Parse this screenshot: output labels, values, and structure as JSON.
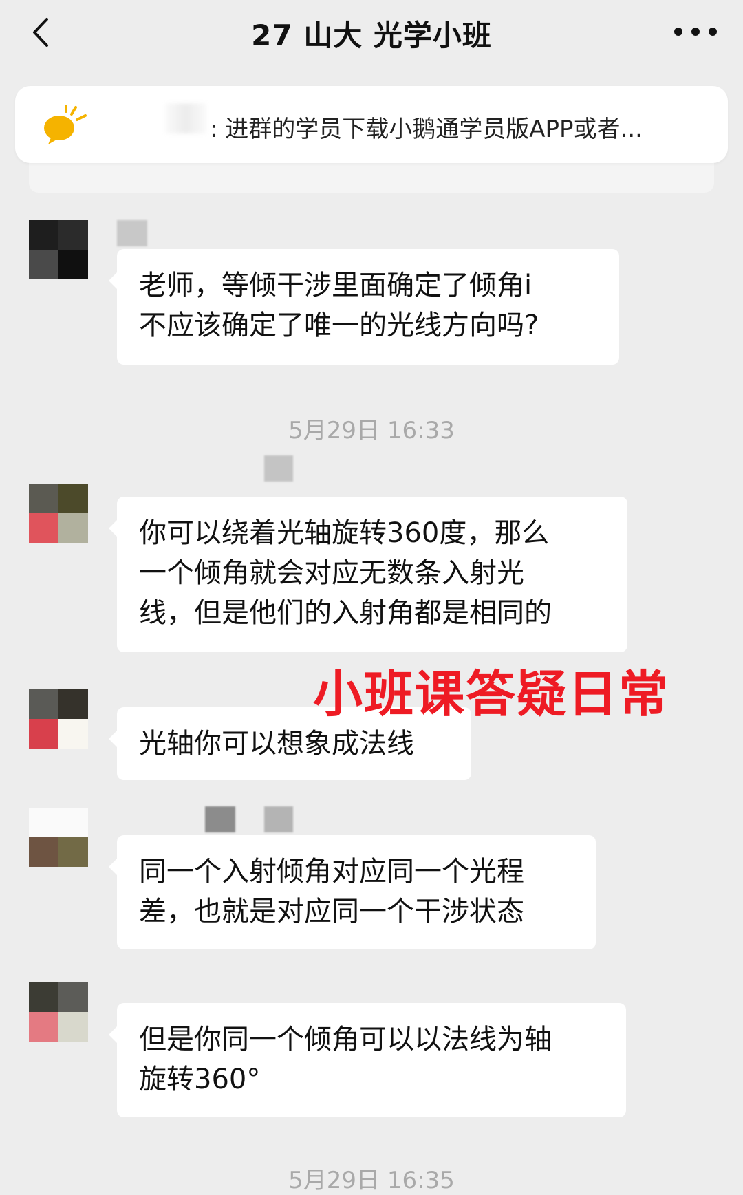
{
  "header": {
    "title": "27 山大 光学小班",
    "back_icon": "chevron-left-icon",
    "more_icon": "more-dots-icon"
  },
  "notice": {
    "icon": "lightbulb-icon",
    "text": ": 进群的学员下载小鹅通学员版APP或者..."
  },
  "messages": [
    {
      "text": "老师，等倾干涉里面确定了倾角i\n不应该确定了唯一的光线方向吗?"
    },
    {
      "timestamp": "5月29日 16:33"
    },
    {
      "text": "你可以绕着光轴旋转360度，那么\n一个倾角就会对应无数条入射光\n线，但是他们的入射角都是相同的"
    },
    {
      "text": "光轴你可以想象成法线"
    },
    {
      "text": "同一个入射倾角对应同一个光程\n差，也就是对应同一个干涉状态"
    },
    {
      "text": "但是你同一个倾角可以以法线为轴\n旋转360°"
    },
    {
      "timestamp": "5月29日 16:35"
    }
  ],
  "overlay_caption": "小班课答疑日常",
  "colors": {
    "background": "#ededed",
    "bubble": "#ffffff",
    "overlay": "#ee1b24",
    "timestamp": "#a9a9a9"
  }
}
